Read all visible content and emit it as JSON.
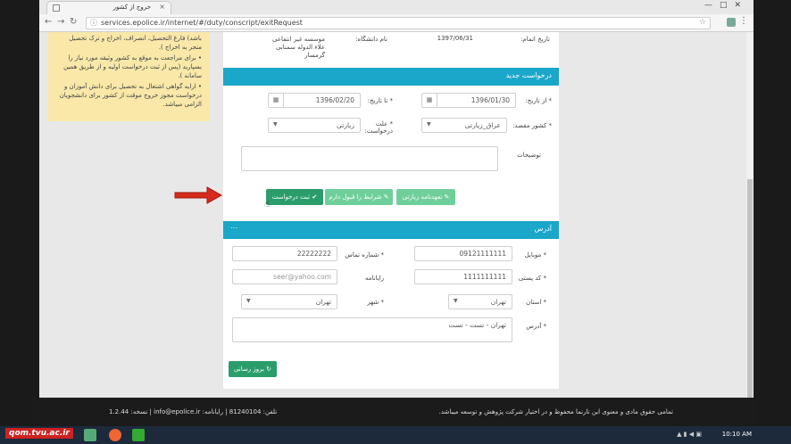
{
  "browser": {
    "tab_title": "خروج از کشور",
    "url": "services.epolice.ir/internet/#/duty/conscript/exitRequest"
  },
  "notice": {
    "items": [
      "باشد) فارغ التحصیل، انصراف، اخراج و ترک تحصیل منجر به اخراج ).",
      "برای مراجعت به موقع به کشور وثیقه مورد نیاز را بسپارید (پس از ثبت درخواست اولیه و از طریق همین سامانه ).",
      "ارایه گواهی اشتغال به تحصیل برای دانش آموزان و درخواست مجوز خروج موقت از کشور برای دانشجویان الزامی میباشد."
    ]
  },
  "top": {
    "date_label": "تاریخ اتمام:",
    "date_value": "1397/06/31",
    "university_label": "نام دانشگاه:",
    "university_value": "موسسه غیر انتفاعی علاء الدوله سمنانی گرمسار"
  },
  "new_request": {
    "title": "درخواست جدید",
    "from_date_label": "* از تاریخ:",
    "from_date_value": "1396/01/30",
    "to_date_label": "* تا تاریخ:",
    "to_date_value": "1396/02/20",
    "dest_label": "* کشور مقصد:",
    "dest_value": "عراق_زیارتی",
    "reason_label": "* علت درخواست:",
    "reason_value": "زیارتی",
    "desc_label": "توضیحات",
    "submit_label": "ثبت درخواست",
    "rules_label": "شرایط را قبول دارم",
    "pledge_label": "تعهدنامه زیارتی"
  },
  "address": {
    "title": "آدرس",
    "mobile_label": "* موبایل",
    "mobile_value": "09121111111",
    "phone_label": "* شماره تماس",
    "phone_value": "22222222",
    "postal_label": "* کد پستی",
    "postal_value": "1111111111",
    "email_label": "رایانامه",
    "email_placeholder": "seer@yahoo.com",
    "province_label": "* استان",
    "province_value": "تهران",
    "city_label": "* شهر",
    "city_value": "تهران",
    "addr_label": "* آدرس",
    "addr_value": "تهران - تست - تست",
    "update_label": "بروز رسانی"
  },
  "footer": {
    "copyright": "تمامی حقوق مادی و معنوی این تارنما محفوظ و در اختیار شرکت پژوهش و توسعه میباشد.",
    "contact": "تلفن: 81240104 | رایانامه: info@epolice.ir | نسخه: 1.2.44"
  },
  "taskbar": {
    "watermark": "qom.tvu.ac.ir",
    "clock": "10:10 AM"
  }
}
